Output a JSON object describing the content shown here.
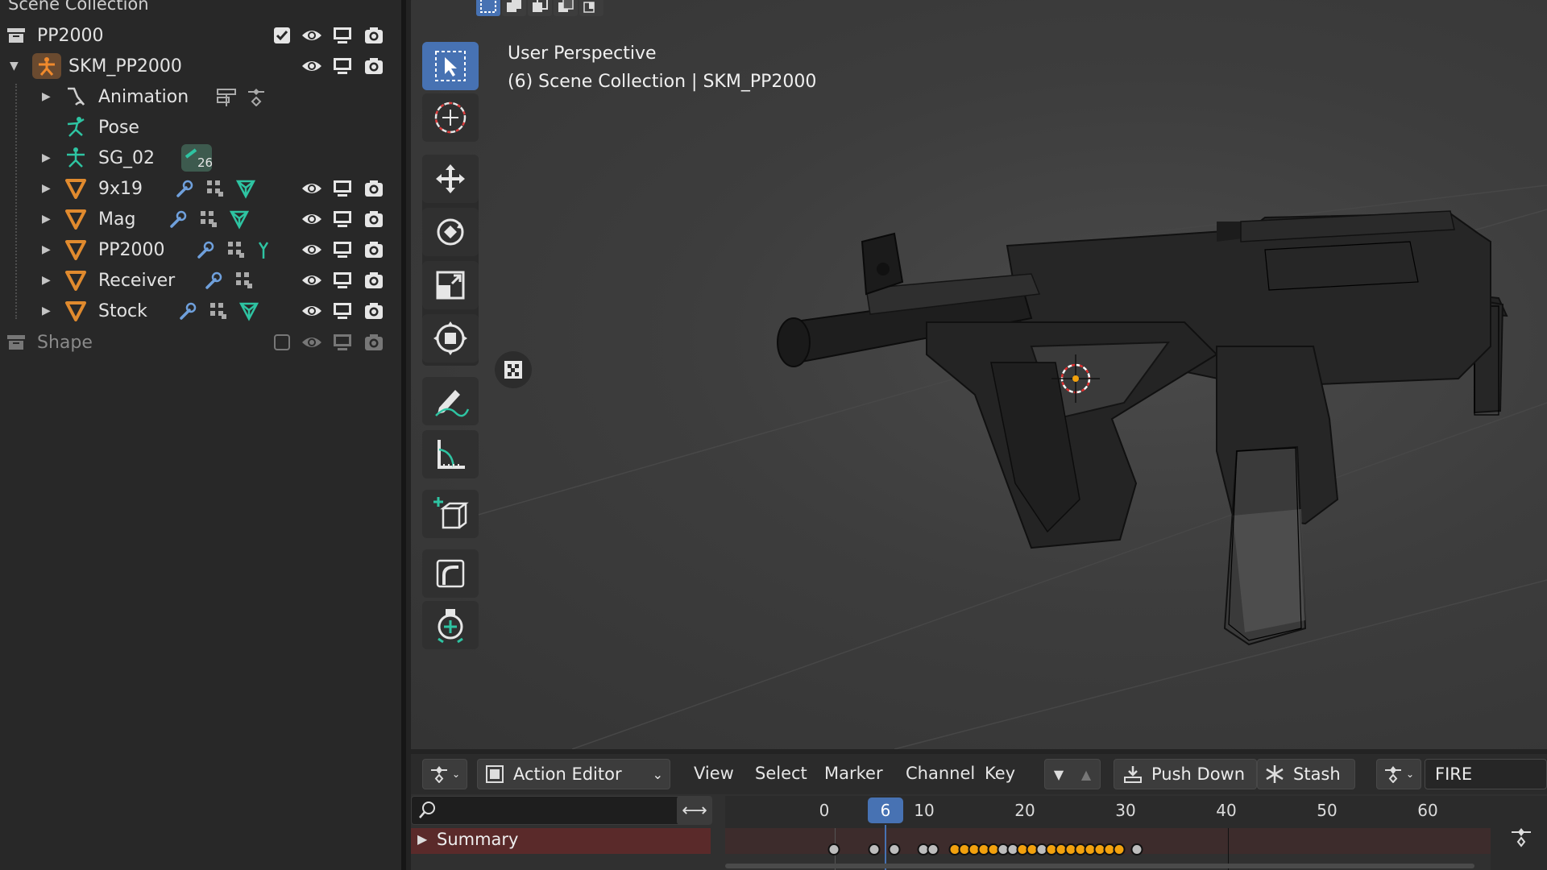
{
  "outliner": {
    "header": "Scene Collection",
    "rows": [
      {
        "label": "PP2000"
      },
      {
        "label": "SKM_PP2000"
      },
      {
        "label": "Animation"
      },
      {
        "label": "Pose"
      },
      {
        "label": "SG_02",
        "badge": "26"
      },
      {
        "label": "9x19"
      },
      {
        "label": "Mag"
      },
      {
        "label": "PP2000"
      },
      {
        "label": "Receiver"
      },
      {
        "label": "Stock"
      },
      {
        "label": "Shape"
      }
    ]
  },
  "viewport": {
    "perspective": "User Perspective",
    "context": "(6) Scene Collection | SKM_PP2000",
    "tools": [
      "select-box-tool",
      "cursor-tool",
      "move-tool",
      "rotate-tool",
      "scale-tool",
      "transform-tool",
      "annotate-tool",
      "measure-tool",
      "add-cube-tool",
      "bend-tool",
      "shear-tool"
    ]
  },
  "timeline": {
    "editor_mode": "Action Editor",
    "menus": [
      "View",
      "Select",
      "Marker",
      "Channel",
      "Key"
    ],
    "push_down": "Push Down",
    "stash": "Stash",
    "action_name": "FIRE",
    "search_placeholder": "",
    "current_frame": "6",
    "ruler": [
      "0",
      "10",
      "20",
      "30",
      "40",
      "50",
      "60"
    ],
    "summary_label": "Summary"
  },
  "colors": {
    "accent": "#4772b3",
    "keyframe_selected": "#f2a10e",
    "keyframe": "#bdbdbd",
    "summary_row": "#5a2a2a",
    "mesh_icon": "#e08a2e",
    "armature_icon": "#2ec4a2"
  }
}
